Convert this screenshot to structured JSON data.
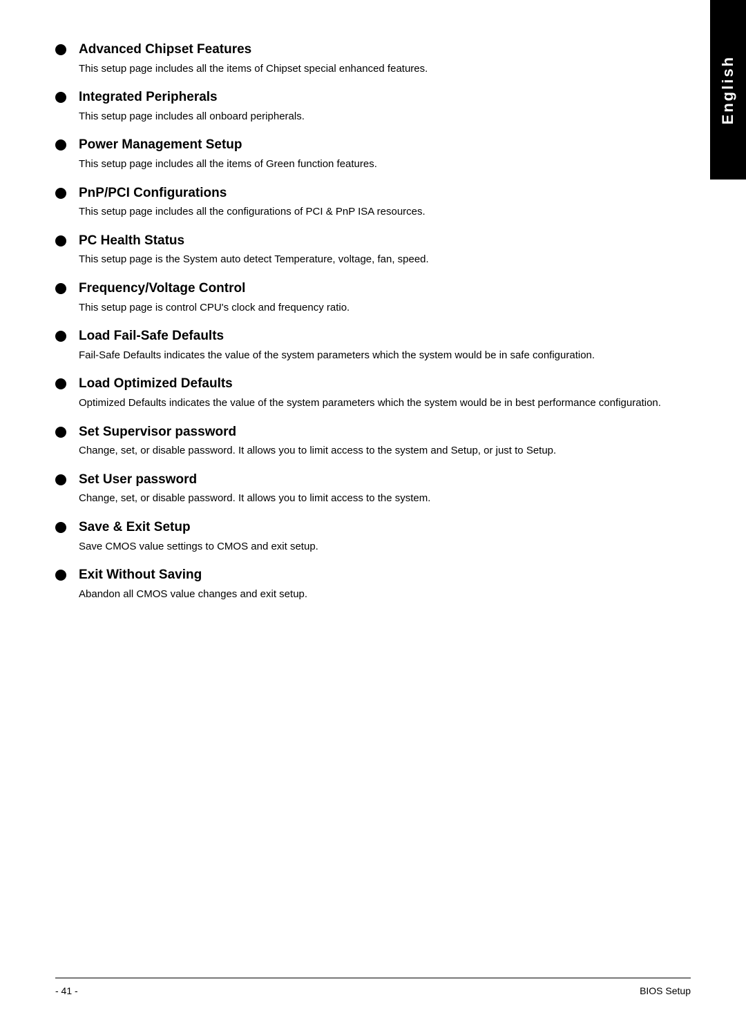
{
  "sidebar": {
    "label": "English"
  },
  "menu": {
    "items": [
      {
        "title": "Advanced Chipset Features",
        "description": "This setup page includes all the items of Chipset special enhanced features."
      },
      {
        "title": "Integrated Peripherals",
        "description": "This setup page includes all onboard peripherals."
      },
      {
        "title": "Power Management Setup",
        "description": "This setup page includes all the items of Green function features."
      },
      {
        "title": "PnP/PCI Configurations",
        "description": "This setup page includes all the configurations of PCI & PnP ISA resources."
      },
      {
        "title": "PC Health Status",
        "description": "This setup page is the System auto detect Temperature, voltage, fan, speed."
      },
      {
        "title": "Frequency/Voltage Control",
        "description": "This setup page is control CPU's clock and frequency ratio."
      },
      {
        "title": "Load Fail-Safe Defaults",
        "description": "Fail-Safe Defaults indicates the value of the system parameters which the system would be in safe configuration."
      },
      {
        "title": "Load Optimized Defaults",
        "description": "Optimized Defaults indicates the value of the system parameters which the system would be in best performance configuration."
      },
      {
        "title": "Set Supervisor password",
        "description": "Change, set, or disable password. It allows you to limit access to the system and Setup, or just to Setup."
      },
      {
        "title": "Set User password",
        "description": "Change, set, or disable password. It allows you to limit access to the system."
      },
      {
        "title": "Save & Exit Setup",
        "description": "Save CMOS value settings to CMOS and exit setup."
      },
      {
        "title": "Exit Without Saving",
        "description": "Abandon all CMOS value changes and exit setup."
      }
    ]
  },
  "footer": {
    "page": "- 41 -",
    "title": "BIOS Setup"
  }
}
